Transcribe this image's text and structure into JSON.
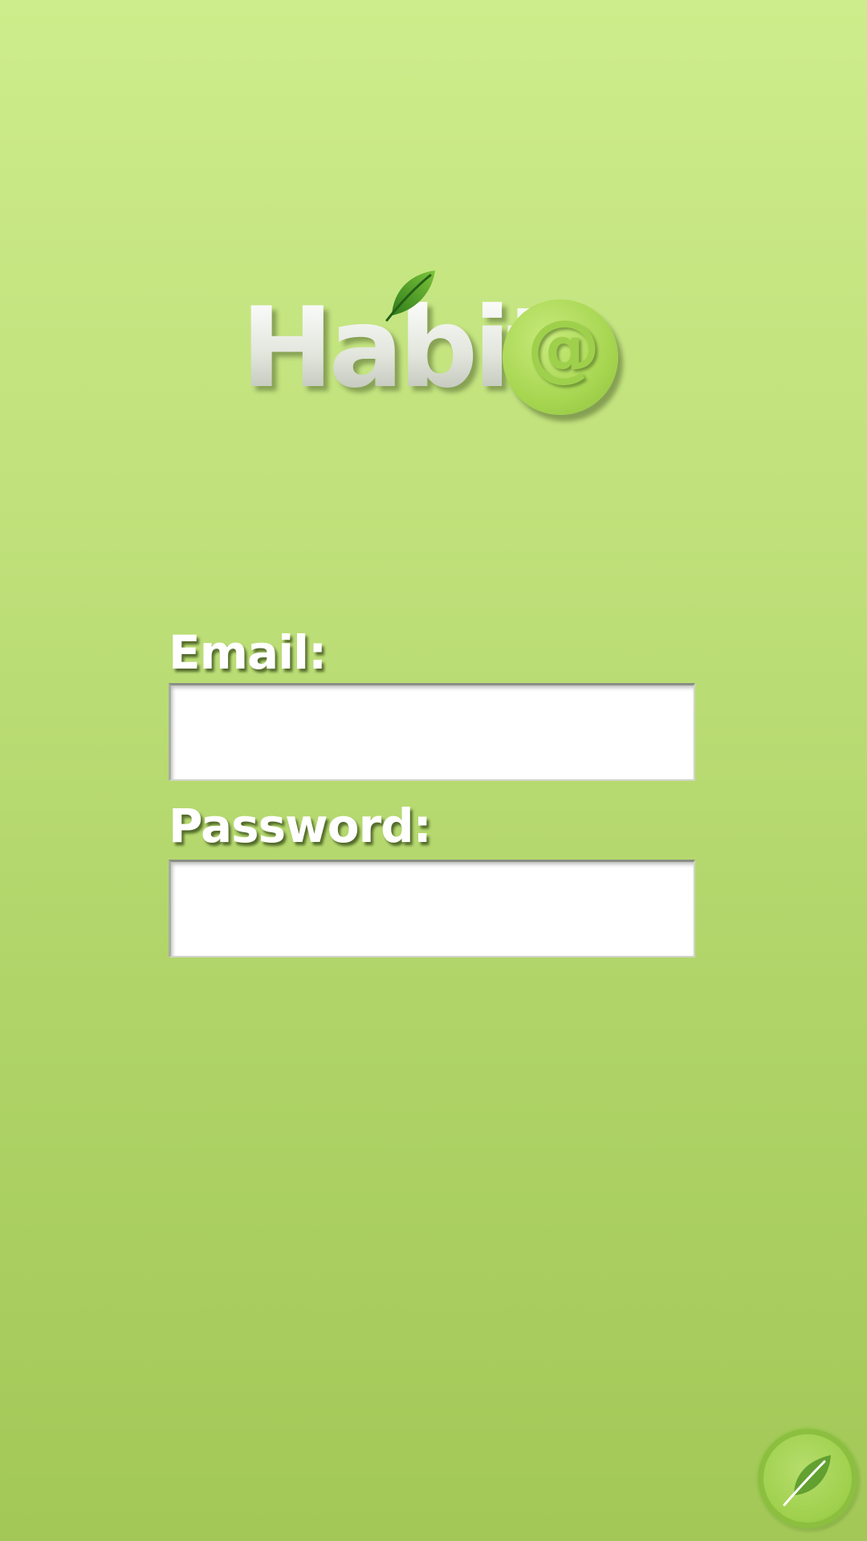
{
  "app": {
    "logo_text": "Habit",
    "logo_at": "@"
  },
  "form": {
    "email_label": "Email:",
    "email_value": "",
    "password_label": "Password:",
    "password_value": ""
  },
  "icons": {
    "logo_leaf": "leaf-icon",
    "corner_button": "leaf-icon"
  },
  "colors": {
    "background_top": "#cdec8b",
    "background_bottom": "#a3c857",
    "accent_green": "#9fd04c",
    "leaf_dark": "#2e7d1f"
  }
}
